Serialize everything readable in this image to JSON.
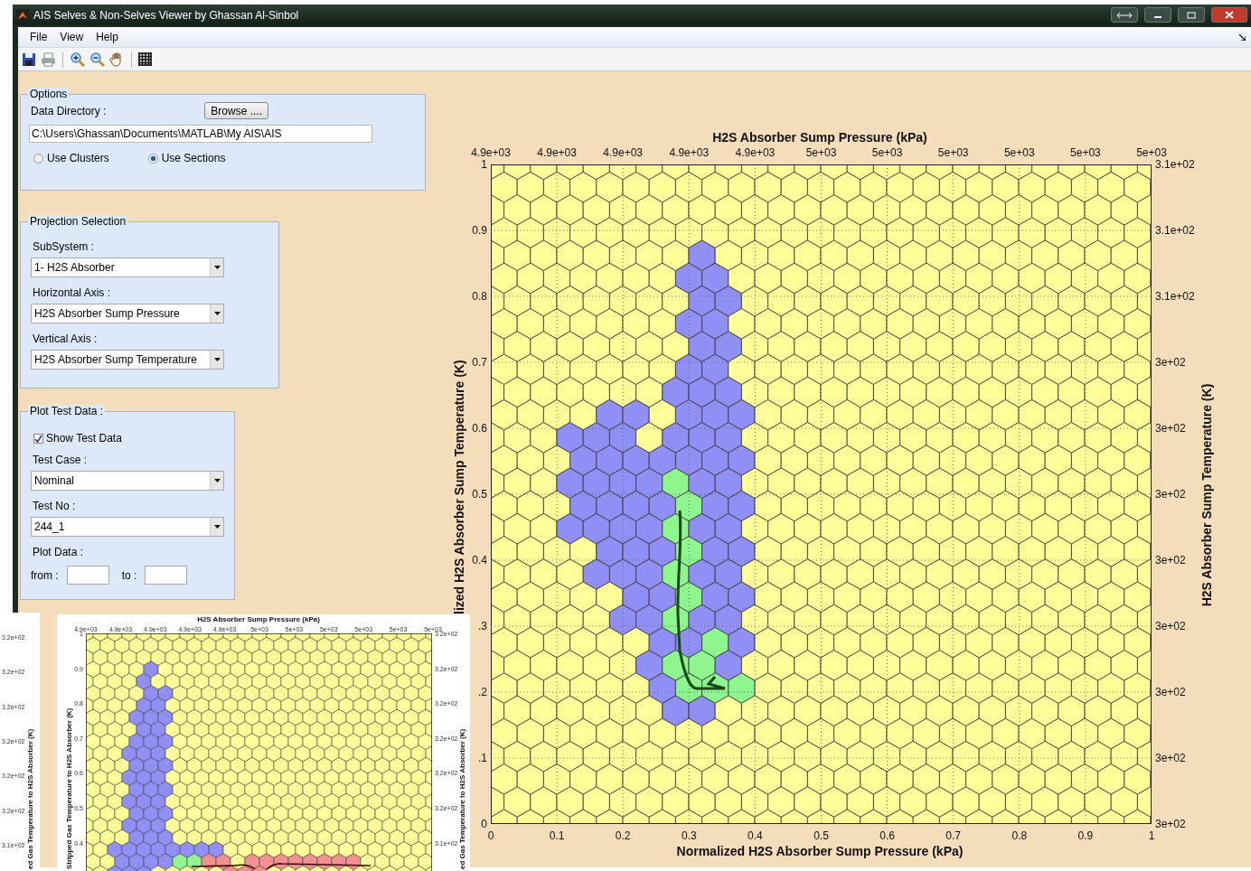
{
  "window": {
    "title": "AIS Selves & Non-Selves Viewer by Ghassan Al-Sinbol"
  },
  "menu": [
    "File",
    "View",
    "Help"
  ],
  "options": {
    "title": "Options",
    "directory_label": "Data Directory :",
    "browse_button": "Browse ....",
    "directory": "C:\\Users\\Ghassan\\Documents\\MATLAB\\My AIS\\AIS",
    "modes": [
      {
        "label": "Use Clusters",
        "selected": false
      },
      {
        "label": "Use Sections",
        "selected": true
      }
    ]
  },
  "projection": {
    "title": "Projection Selection",
    "fields": [
      {
        "label": "SubSystem :",
        "value": "1- H2S Absorber"
      },
      {
        "label": "Horizontal Axis :",
        "value": "H2S Absorber Sump Pressure"
      },
      {
        "label": "Vertical Axis :",
        "value": "H2S Absorber Sump Temperature"
      }
    ]
  },
  "test_data": {
    "title": "Plot Test Data :",
    "show": {
      "label": "Show Test Data",
      "checked": true
    },
    "fields": [
      {
        "label": "Test Case :",
        "value": "Nominal"
      },
      {
        "label": "Test No :",
        "value": "244_1"
      }
    ],
    "range_label": "Plot Data :",
    "from_label": "from :",
    "to_label": "to :"
  },
  "chart": {
    "title": "H2S Absorber Sump Pressure (kPa)",
    "top_ticks": [
      "4.9e+03",
      "4.9e+03",
      "4.9e+03",
      "4.9e+03",
      "4.9e+03",
      "5e+03",
      "5e+03",
      "5e+03",
      "5e+03",
      "5e+03",
      "5e+03"
    ],
    "left_ticks": [
      "1",
      "0.9",
      "0.8",
      "0.7",
      "0.6",
      "0.5",
      "0.4",
      ".3",
      ".2",
      ".1",
      "0"
    ],
    "right_ticks": [
      "3.1e+02",
      "3.1e+02",
      "3.1e+02",
      "3e+02",
      "3e+02",
      "3e+02",
      "3e+02",
      "3e+02",
      "3e+02",
      "3e+02",
      "3e+02"
    ],
    "bottom_ticks": [
      "0",
      "0.1",
      "0.2",
      "0.3",
      "0.4",
      "0.5",
      "0.6",
      "0.7",
      "0.8",
      "0.9",
      "1"
    ],
    "xlabel": "Normalized H2S Absorber Sump Pressure (kPa)",
    "ylabel": "lized H2S Absorber Sump Temperature (K)",
    "y2label": "H2S Absorber Sump Temperature (K)"
  },
  "mini_chart": {
    "title": "H2S Absorber Sump Pressure (kPa)",
    "top_ticks": [
      "4.9e+03",
      "4.9e+03",
      "4.9e+03",
      "4.9e+03",
      "4.9e+03",
      "5e+03",
      "5e+03",
      "5e+03",
      "5e+03",
      "5e+03",
      "5e+03"
    ],
    "left_ticks": [
      "1",
      "0.9",
      "0.8",
      "0.7",
      "0.6",
      "0.5",
      "0.4"
    ],
    "right_ticks": [
      "3.2e+02",
      "3.2e+02",
      "3.2e+02",
      "3.2e+02",
      "3.2e+02",
      "3.2e+02",
      "3.1e+02"
    ],
    "ylabel": "Stripped Gas Temperature to H2S Absorber (K)",
    "y2label": "ed Gas Temperature to H2S Absorber (K)"
  },
  "side_window": {
    "ticks": [
      "3.2e+02",
      "3.2e+02",
      "3.2e+02",
      "3.2e+02",
      "3.2e+02",
      "3.2e+02",
      "3.1e+02"
    ],
    "ylabel": "ed Gas Temperature to H2S Absorber (K)"
  }
}
